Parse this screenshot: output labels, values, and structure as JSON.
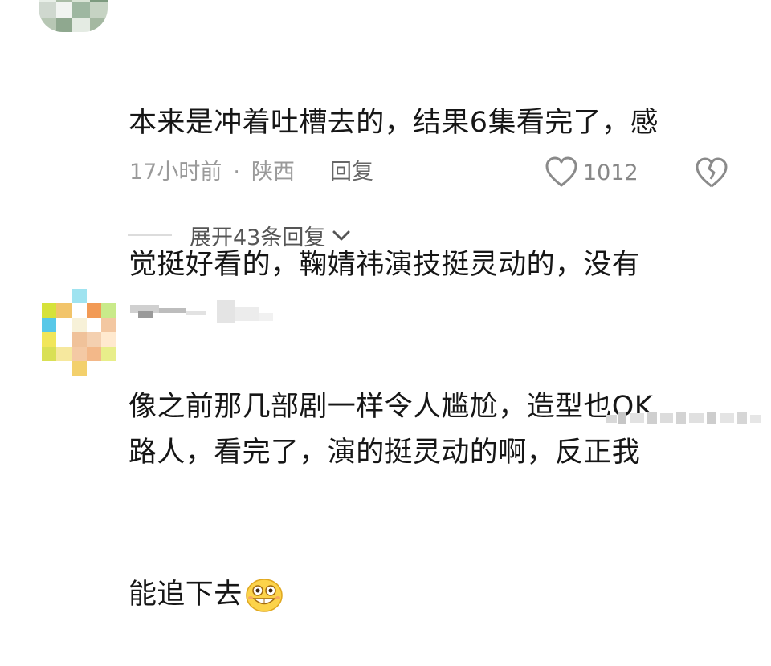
{
  "comment1": {
    "lines": [
      "本来是冲着吐槽去的，结果6集看完了，感",
      "觉挺好看的，鞠婧祎演技挺灵动的，没有",
      "像之前那几部剧一样令人尴尬，造型也OK"
    ],
    "time": "17小时前",
    "separator": "·",
    "location": "陕西",
    "reply_label": "回复",
    "like_count": "1012",
    "expand_label": "展开43条回复"
  },
  "comment2": {
    "lines": [
      "路人，看完了，演的挺灵动的啊，反正我",
      "能追下去"
    ],
    "emoji": "grinning-face-emoji"
  },
  "colors": {
    "text": "#161616",
    "meta": "#9a9a9a",
    "icon": "#888888"
  }
}
